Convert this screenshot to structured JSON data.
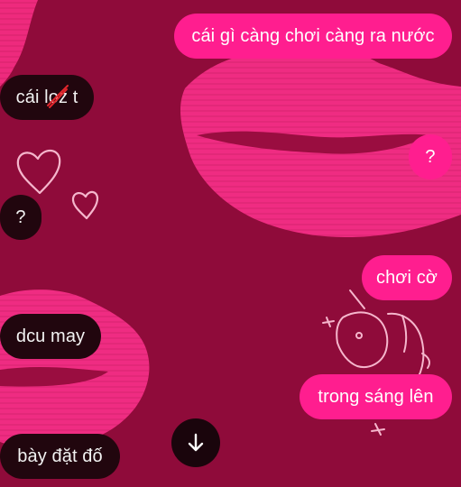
{
  "chat": {
    "messages": [
      {
        "id": "m1",
        "direction": "outgoing",
        "text": "cái gì càng chơi càng ra nước"
      },
      {
        "id": "m2",
        "direction": "incoming",
        "text_before": "cái l",
        "text_struck": "o",
        "text_after": "z t"
      },
      {
        "id": "m3",
        "direction": "outgoing",
        "text": "?"
      },
      {
        "id": "m4",
        "direction": "incoming",
        "text": "?"
      },
      {
        "id": "m5",
        "direction": "outgoing",
        "text": "chơi cờ"
      },
      {
        "id": "m6",
        "direction": "incoming",
        "text": "dcu may"
      },
      {
        "id": "m7",
        "direction": "outgoing",
        "text": "trong sáng lên"
      },
      {
        "id": "m8",
        "direction": "incoming",
        "text": "bày đặt đố"
      }
    ],
    "scroll_down_icon": "arrow-down-icon"
  },
  "theme": {
    "background": "#8f0b3a",
    "incoming_bubble": "#21060e",
    "outgoing_bubble": "#ff1e8f",
    "wallpaper_accent": "#ff2f86",
    "strike_color": "#e3262c"
  }
}
